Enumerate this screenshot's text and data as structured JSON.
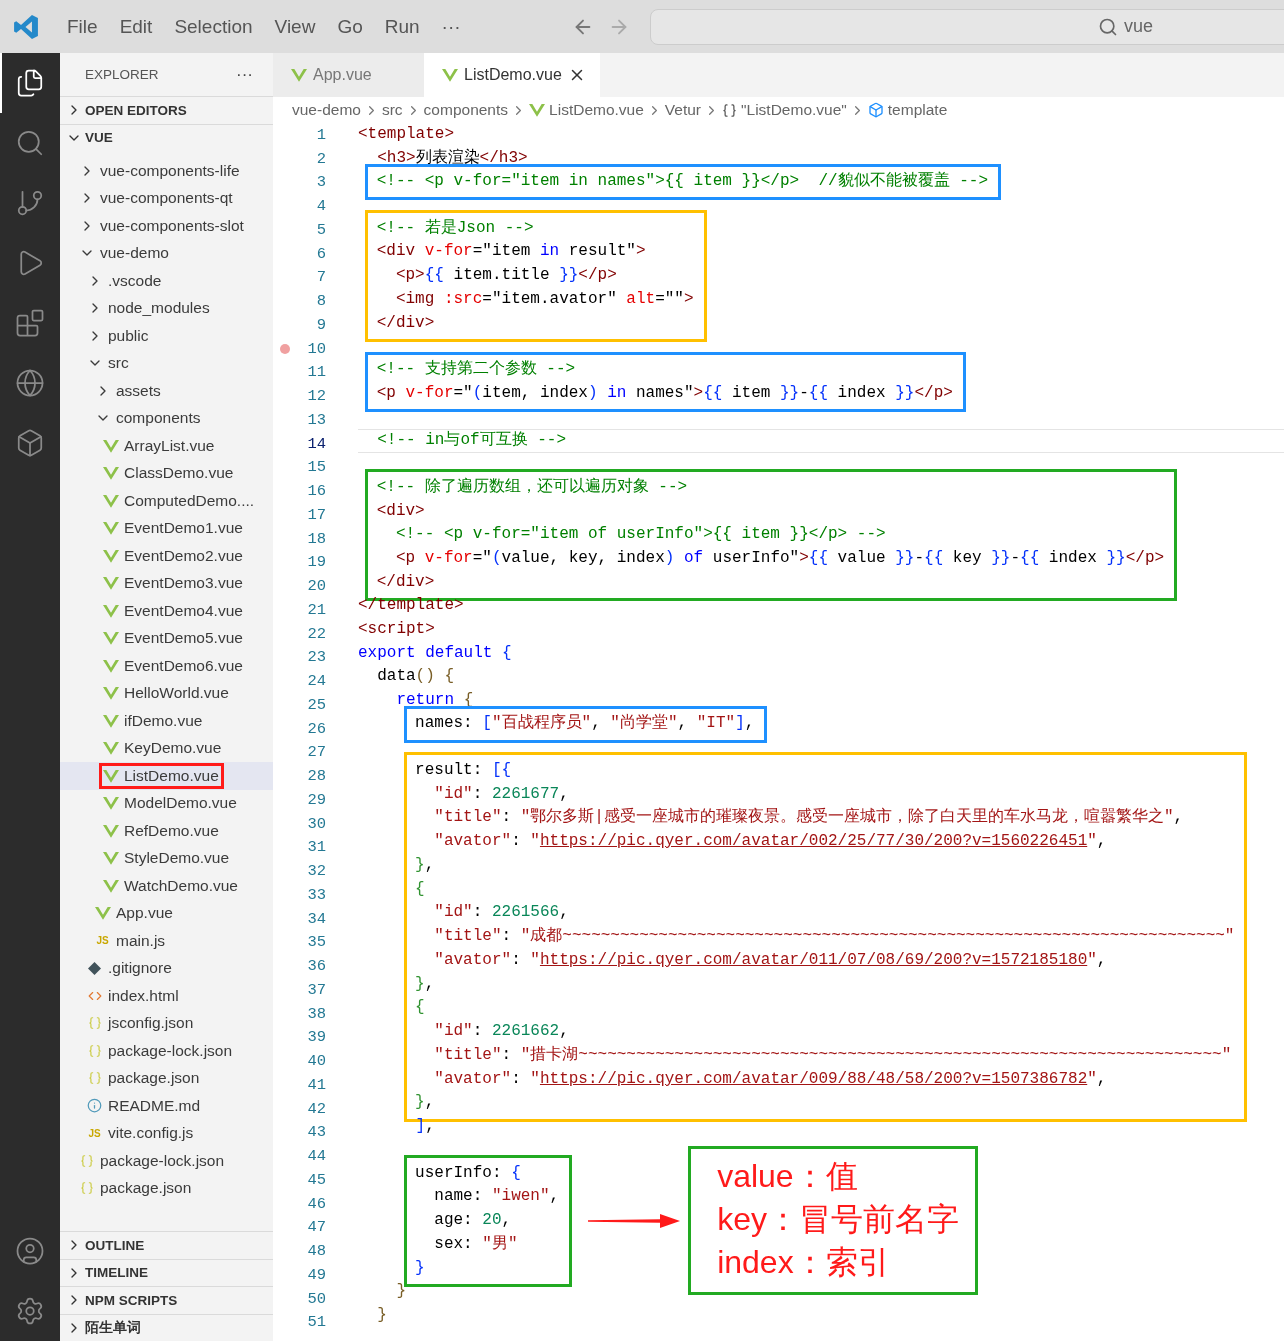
{
  "title_bar": {
    "menu": [
      "File",
      "Edit",
      "Selection",
      "View",
      "Go",
      "Run",
      "···"
    ],
    "command_center": "vue"
  },
  "activity_bar": {
    "top": [
      {
        "kind": "files",
        "selected": true
      },
      {
        "kind": "search",
        "selected": false
      },
      {
        "kind": "source-control",
        "selected": false
      },
      {
        "kind": "run",
        "selected": false
      },
      {
        "kind": "extensions",
        "selected": false
      },
      {
        "kind": "globe",
        "selected": false
      },
      {
        "kind": "cube",
        "selected": false
      }
    ],
    "bottom": [
      {
        "kind": "account"
      },
      {
        "kind": "settings"
      }
    ]
  },
  "explorer": {
    "title": "EXPLORER",
    "more": "···",
    "sections": [
      {
        "label": "OPEN EDITORS",
        "expanded": false
      },
      {
        "label": "VUE",
        "expanded": true,
        "tree": [
          {
            "label": "vue-components-life",
            "kind": "folder",
            "expanded": false,
            "selected": false,
            "outlined": false
          },
          {
            "label": "vue-components-qt",
            "kind": "folder",
            "expanded": false,
            "selected": false,
            "outlined": false
          },
          {
            "label": "vue-components-slot",
            "kind": "folder",
            "expanded": false,
            "selected": false,
            "outlined": false
          },
          {
            "label": "vue-demo",
            "kind": "folder",
            "expanded": true,
            "selected": false,
            "outlined": false,
            "children": [
              {
                "label": ".vscode",
                "kind": "folder",
                "expanded": false,
                "selected": false,
                "outlined": false
              },
              {
                "label": "node_modules",
                "kind": "folder",
                "expanded": false,
                "selected": false,
                "outlined": false
              },
              {
                "label": "public",
                "kind": "folder",
                "expanded": false,
                "selected": false,
                "outlined": false
              },
              {
                "label": "src",
                "kind": "folder",
                "expanded": true,
                "selected": false,
                "outlined": false,
                "children": [
                  {
                    "label": "assets",
                    "kind": "folder",
                    "expanded": false,
                    "selected": false,
                    "outlined": false
                  },
                  {
                    "label": "components",
                    "kind": "folder",
                    "expanded": true,
                    "selected": false,
                    "outlined": false,
                    "children": [
                      {
                        "label": "ArrayList.vue",
                        "kind": "vue",
                        "selected": false,
                        "outlined": false
                      },
                      {
                        "label": "ClassDemo.vue",
                        "kind": "vue",
                        "selected": false,
                        "outlined": false
                      },
                      {
                        "label": "ComputedDemo....",
                        "kind": "vue",
                        "selected": false,
                        "outlined": false
                      },
                      {
                        "label": "EventDemo1.vue",
                        "kind": "vue",
                        "selected": false,
                        "outlined": false
                      },
                      {
                        "label": "EventDemo2.vue",
                        "kind": "vue",
                        "selected": false,
                        "outlined": false
                      },
                      {
                        "label": "EventDemo3.vue",
                        "kind": "vue",
                        "selected": false,
                        "outlined": false
                      },
                      {
                        "label": "EventDemo4.vue",
                        "kind": "vue",
                        "selected": false,
                        "outlined": false
                      },
                      {
                        "label": "EventDemo5.vue",
                        "kind": "vue",
                        "selected": false,
                        "outlined": false
                      },
                      {
                        "label": "EventDemo6.vue",
                        "kind": "vue",
                        "selected": false,
                        "outlined": false
                      },
                      {
                        "label": "HelloWorld.vue",
                        "kind": "vue",
                        "selected": false,
                        "outlined": false
                      },
                      {
                        "label": "ifDemo.vue",
                        "kind": "vue",
                        "selected": false,
                        "outlined": false
                      },
                      {
                        "label": "KeyDemo.vue",
                        "kind": "vue",
                        "selected": false,
                        "outlined": false
                      },
                      {
                        "label": "ListDemo.vue",
                        "kind": "vue",
                        "selected": true,
                        "outlined": true
                      },
                      {
                        "label": "ModelDemo.vue",
                        "kind": "vue",
                        "selected": false,
                        "outlined": false
                      },
                      {
                        "label": "RefDemo.vue",
                        "kind": "vue",
                        "selected": false,
                        "outlined": false
                      },
                      {
                        "label": "StyleDemo.vue",
                        "kind": "vue",
                        "selected": false,
                        "outlined": false
                      },
                      {
                        "label": "WatchDemo.vue",
                        "kind": "vue",
                        "selected": false,
                        "outlined": false
                      }
                    ]
                  },
                  {
                    "label": "App.vue",
                    "kind": "vue",
                    "selected": false,
                    "outlined": false
                  },
                  {
                    "label": "main.js",
                    "kind": "js",
                    "icon_text": "JS",
                    "selected": false,
                    "outlined": false
                  }
                ]
              },
              {
                "label": ".gitignore",
                "kind": "git",
                "selected": false,
                "outlined": false
              },
              {
                "label": "index.html",
                "kind": "html",
                "selected": false,
                "outlined": false
              },
              {
                "label": "jsconfig.json",
                "kind": "json",
                "selected": false,
                "outlined": false
              },
              {
                "label": "package-lock.json",
                "kind": "json",
                "selected": false,
                "outlined": false
              },
              {
                "label": "package.json",
                "kind": "json",
                "selected": false,
                "outlined": false
              },
              {
                "label": "README.md",
                "kind": "info",
                "selected": false,
                "outlined": false
              },
              {
                "label": "vite.config.js",
                "kind": "js",
                "icon_text": "JS",
                "selected": false,
                "outlined": false
              }
            ]
          },
          {
            "label": "package-lock.json",
            "kind": "json",
            "selected": false,
            "outlined": false
          },
          {
            "label": "package.json",
            "kind": "json",
            "selected": false,
            "outlined": false
          }
        ]
      }
    ],
    "bottom_sections": [
      {
        "label": "OUTLINE",
        "expanded": false
      },
      {
        "label": "TIMELINE",
        "expanded": false
      },
      {
        "label": "NPM SCRIPTS",
        "expanded": false
      },
      {
        "label": "陌生单词",
        "expanded": false
      }
    ]
  },
  "editor": {
    "tabs": [
      {
        "label": "App.vue",
        "selected": false
      },
      {
        "label": "ListDemo.vue",
        "selected": true
      }
    ],
    "breadcrumbs": [
      {
        "label": "vue-demo",
        "kind": "folder"
      },
      {
        "label": "src",
        "kind": "folder"
      },
      {
        "label": "components",
        "kind": "folder"
      },
      {
        "label": "ListDemo.vue",
        "kind": "vue"
      },
      {
        "label": "Vetur",
        "kind": "folder"
      },
      {
        "label": "\"ListDemo.vue\"",
        "kind": "object"
      },
      {
        "label": "template",
        "kind": "element"
      }
    ],
    "blocks": [
      {
        "kind": "plain",
        "lines": [
          {
            "number": "1",
            "current": false,
            "breakpoint": false,
            "tokens": [
              {
                "kind": "tag",
                "text": "<template>"
              }
            ]
          },
          {
            "number": "2",
            "current": false,
            "breakpoint": false,
            "tokens": [
              {
                "kind": "tag",
                "text": "  <h3>"
              },
              {
                "kind": "plain",
                "text": "列表渲染"
              },
              {
                "kind": "tag",
                "text": "</h3>"
              }
            ]
          }
        ]
      },
      {
        "kind": "boxed",
        "color": "#1e90ff",
        "lines": [
          {
            "number": "3",
            "current": false,
            "breakpoint": false,
            "tokens": [
              {
                "kind": "comment",
                "text": "  <!-- <p v-for=\"item in names\">{{ item }}</p>  //貌似不能被覆盖 -->"
              }
            ]
          }
        ]
      },
      {
        "kind": "plain",
        "lines": [
          {
            "number": "4",
            "current": false,
            "breakpoint": false
          }
        ]
      },
      {
        "kind": "boxed",
        "color": "#ffc000",
        "lines": [
          {
            "number": "5",
            "current": false,
            "breakpoint": false,
            "tokens": [
              {
                "kind": "comment",
                "text": "  <!-- 若是Json -->"
              }
            ]
          },
          {
            "number": "6",
            "current": false,
            "breakpoint": false,
            "tokens": [
              {
                "kind": "tag",
                "text": "  <div"
              },
              {
                "kind": "attr",
                "text": " v-for"
              },
              {
                "kind": "plain",
                "text": "=\"item "
              },
              {
                "kind": "keyword",
                "text": "in"
              },
              {
                "kind": "plain",
                "text": " result\""
              },
              {
                "kind": "tag",
                "text": ">"
              }
            ]
          },
          {
            "number": "7",
            "current": false,
            "breakpoint": false,
            "tokens": [
              {
                "kind": "tag",
                "text": "    <p>"
              },
              {
                "kind": "brace",
                "text": "{{"
              },
              {
                "kind": "plain",
                "text": " item.title "
              },
              {
                "kind": "brace",
                "text": "}}"
              },
              {
                "kind": "tag",
                "text": "</p>"
              }
            ]
          },
          {
            "number": "8",
            "current": false,
            "breakpoint": false,
            "tokens": [
              {
                "kind": "tag",
                "text": "    <img"
              },
              {
                "kind": "attr",
                "text": " :src"
              },
              {
                "kind": "plain",
                "text": "=\"item.avator\""
              },
              {
                "kind": "attr",
                "text": " alt"
              },
              {
                "kind": "plain",
                "text": "=\"\""
              },
              {
                "kind": "tag",
                "text": ">"
              }
            ]
          },
          {
            "number": "9",
            "current": false,
            "breakpoint": false,
            "tokens": [
              {
                "kind": "tag",
                "text": "  </div>"
              }
            ]
          }
        ]
      },
      {
        "kind": "plain",
        "lines": [
          {
            "number": "10",
            "current": false,
            "breakpoint": true
          }
        ]
      },
      {
        "kind": "boxed",
        "color": "#1e90ff",
        "lines": [
          {
            "number": "11",
            "current": false,
            "breakpoint": false,
            "tokens": [
              {
                "kind": "comment",
                "text": "  <!-- 支持第二个参数 -->"
              }
            ]
          },
          {
            "number": "12",
            "current": false,
            "breakpoint": false,
            "tokens": [
              {
                "kind": "tag",
                "text": "  <p"
              },
              {
                "kind": "attr",
                "text": " v-for"
              },
              {
                "kind": "plain",
                "text": "=\""
              },
              {
                "kind": "brace",
                "text": "("
              },
              {
                "kind": "plain",
                "text": "item, index"
              },
              {
                "kind": "brace",
                "text": ") "
              },
              {
                "kind": "keyword",
                "text": "in"
              },
              {
                "kind": "plain",
                "text": " names\""
              },
              {
                "kind": "tag",
                "text": ">"
              },
              {
                "kind": "brace",
                "text": "{{"
              },
              {
                "kind": "plain",
                "text": " item "
              },
              {
                "kind": "brace",
                "text": "}}"
              },
              {
                "kind": "plain",
                "text": "-"
              },
              {
                "kind": "brace",
                "text": "{{"
              },
              {
                "kind": "plain",
                "text": " index "
              },
              {
                "kind": "brace",
                "text": "}}"
              },
              {
                "kind": "tag",
                "text": "</p>"
              }
            ]
          }
        ]
      },
      {
        "kind": "plain",
        "lines": [
          {
            "number": "13",
            "current": false,
            "breakpoint": false
          },
          {
            "number": "14",
            "current": true,
            "breakpoint": false,
            "tokens": [
              {
                "kind": "comment",
                "text": "  <!-- in与of可互换 -->"
              }
            ]
          },
          {
            "number": "15",
            "current": false,
            "breakpoint": false
          }
        ]
      },
      {
        "kind": "boxed",
        "color": "#22aa22",
        "lines": [
          {
            "number": "16",
            "current": false,
            "breakpoint": false,
            "tokens": [
              {
                "kind": "comment",
                "text": "  <!-- 除了遍历数组，还可以遍历对象 -->"
              }
            ]
          },
          {
            "number": "17",
            "current": false,
            "breakpoint": false,
            "tokens": [
              {
                "kind": "tag",
                "text": "  <div>"
              }
            ]
          },
          {
            "number": "18",
            "current": false,
            "breakpoint": false,
            "tokens": [
              {
                "kind": "comment",
                "text": "    <!-- <p v-for=\"item of userInfo\">{{ item }}</p> -->"
              }
            ]
          },
          {
            "number": "19",
            "current": false,
            "breakpoint": false,
            "tokens": [
              {
                "kind": "tag",
                "text": "    <p"
              },
              {
                "kind": "attr",
                "text": " v-for"
              },
              {
                "kind": "plain",
                "text": "=\""
              },
              {
                "kind": "brace",
                "text": "("
              },
              {
                "kind": "plain",
                "text": "value, key, index"
              },
              {
                "kind": "brace",
                "text": ") "
              },
              {
                "kind": "keyword",
                "text": "of"
              },
              {
                "kind": "plain",
                "text": " userInfo\""
              },
              {
                "kind": "tag",
                "text": ">"
              },
              {
                "kind": "brace",
                "text": "{{"
              },
              {
                "kind": "plain",
                "text": " value "
              },
              {
                "kind": "brace",
                "text": "}}"
              },
              {
                "kind": "plain",
                "text": "-"
              },
              {
                "kind": "brace",
                "text": "{{"
              },
              {
                "kind": "plain",
                "text": " key "
              },
              {
                "kind": "brace",
                "text": "}}"
              },
              {
                "kind": "plain",
                "text": "-"
              },
              {
                "kind": "brace",
                "text": "{{"
              },
              {
                "kind": "plain",
                "text": " index "
              },
              {
                "kind": "brace",
                "text": "}}"
              },
              {
                "kind": "tag",
                "text": "</p>"
              }
            ]
          },
          {
            "number": "20",
            "current": false,
            "breakpoint": false,
            "tokens": [
              {
                "kind": "tag",
                "text": "  </div>"
              }
            ]
          }
        ]
      },
      {
        "kind": "plain",
        "lines": [
          {
            "number": "21",
            "current": false,
            "breakpoint": false,
            "tokens": [
              {
                "kind": "tag",
                "text": "</template>"
              }
            ]
          },
          {
            "number": "22",
            "current": false,
            "breakpoint": false,
            "tokens": [
              {
                "kind": "tag",
                "text": "<script>"
              }
            ]
          },
          {
            "number": "23",
            "current": false,
            "breakpoint": false,
            "tokens": [
              {
                "kind": "keyword",
                "text": "export default "
              },
              {
                "kind": "brace",
                "text": "{"
              }
            ]
          },
          {
            "number": "24",
            "current": false,
            "breakpoint": false,
            "tokens": [
              {
                "kind": "plain",
                "text": "  data"
              },
              {
                "kind": "bracket",
                "text": "() {"
              }
            ]
          },
          {
            "number": "25",
            "current": false,
            "breakpoint": false,
            "tokens": [
              {
                "kind": "keyword",
                "text": "    return "
              },
              {
                "kind": "bracket",
                "text": "{"
              }
            ]
          }
        ]
      },
      {
        "kind": "boxed",
        "color": "#1e90ff",
        "lines": [
          {
            "number": "26",
            "current": false,
            "breakpoint": false,
            "tokens": [
              {
                "kind": "plain",
                "text": "      names: "
              },
              {
                "kind": "brace",
                "text": "["
              },
              {
                "kind": "string",
                "text": "\"百战程序员\""
              },
              {
                "kind": "plain",
                "text": ", "
              },
              {
                "kind": "string",
                "text": "\"尚学堂\""
              },
              {
                "kind": "plain",
                "text": ", "
              },
              {
                "kind": "string",
                "text": "\"IT\""
              },
              {
                "kind": "brace",
                "text": "]"
              },
              {
                "kind": "plain",
                "text": ","
              }
            ]
          }
        ]
      },
      {
        "kind": "plain",
        "lines": [
          {
            "number": "27",
            "current": false,
            "breakpoint": false
          }
        ]
      },
      {
        "kind": "boxed",
        "color": "#ffc000",
        "lines": [
          {
            "number": "28",
            "current": false,
            "breakpoint": false,
            "tokens": [
              {
                "kind": "plain",
                "text": "      result: "
              },
              {
                "kind": "brace",
                "text": "[{"
              }
            ]
          },
          {
            "number": "29",
            "current": false,
            "breakpoint": false,
            "tokens": [
              {
                "kind": "string",
                "text": "        \"id\""
              },
              {
                "kind": "plain",
                "text": ": "
              },
              {
                "kind": "number",
                "text": "2261677"
              },
              {
                "kind": "plain",
                "text": ","
              }
            ]
          },
          {
            "number": "30",
            "current": false,
            "breakpoint": false,
            "tokens": [
              {
                "kind": "string",
                "text": "        \"title\""
              },
              {
                "kind": "plain",
                "text": ": "
              },
              {
                "kind": "string",
                "text": "\"鄂尔多斯|感受一座城市的璀璨夜景。感受一座城市，除了白天里的车水马龙，喧嚣繁华之\""
              },
              {
                "kind": "plain",
                "text": ","
              }
            ]
          },
          {
            "number": "31",
            "current": false,
            "breakpoint": false,
            "tokens": [
              {
                "kind": "string",
                "text": "        \"avator\""
              },
              {
                "kind": "plain",
                "text": ": "
              },
              {
                "kind": "string",
                "text": "\""
              },
              {
                "kind": "link",
                "text": "https://pic.qyer.com/avatar/002/25/77/30/200?v=1560226451"
              },
              {
                "kind": "string",
                "text": "\""
              },
              {
                "kind": "plain",
                "text": ","
              }
            ]
          },
          {
            "number": "32",
            "current": false,
            "breakpoint": false,
            "tokens": [
              {
                "kind": "bracket2",
                "text": "      }"
              },
              {
                "kind": "plain",
                "text": ","
              }
            ]
          },
          {
            "number": "33",
            "current": false,
            "breakpoint": false,
            "tokens": [
              {
                "kind": "bracket2",
                "text": "      {"
              }
            ]
          },
          {
            "number": "34",
            "current": false,
            "breakpoint": false,
            "tokens": [
              {
                "kind": "string",
                "text": "        \"id\""
              },
              {
                "kind": "plain",
                "text": ": "
              },
              {
                "kind": "number",
                "text": "2261566"
              },
              {
                "kind": "plain",
                "text": ","
              }
            ]
          },
          {
            "number": "35",
            "current": false,
            "breakpoint": false,
            "tokens": [
              {
                "kind": "string",
                "text": "        \"title\""
              },
              {
                "kind": "plain",
                "text": ": "
              },
              {
                "kind": "string",
                "text": "\"成都~~~~~~~~~~~~~~~~~~~~~~~~~~~~~~~~~~~~~~~~~~~~~~~~~~~~~~~~~~~~~~~~~~~~~\""
              }
            ]
          },
          {
            "number": "36",
            "current": false,
            "breakpoint": false,
            "tokens": [
              {
                "kind": "string",
                "text": "        \"avator\""
              },
              {
                "kind": "plain",
                "text": ": "
              },
              {
                "kind": "string",
                "text": "\""
              },
              {
                "kind": "link",
                "text": "https://pic.qyer.com/avatar/011/07/08/69/200?v=1572185180"
              },
              {
                "kind": "string",
                "text": "\""
              },
              {
                "kind": "plain",
                "text": ","
              }
            ]
          },
          {
            "number": "37",
            "current": false,
            "breakpoint": false,
            "tokens": [
              {
                "kind": "bracket2",
                "text": "      }"
              },
              {
                "kind": "plain",
                "text": ","
              }
            ]
          },
          {
            "number": "38",
            "current": false,
            "breakpoint": false,
            "tokens": [
              {
                "kind": "bracket2",
                "text": "      {"
              }
            ]
          },
          {
            "number": "39",
            "current": false,
            "breakpoint": false,
            "tokens": [
              {
                "kind": "string",
                "text": "        \"id\""
              },
              {
                "kind": "plain",
                "text": ": "
              },
              {
                "kind": "number",
                "text": "2261662"
              },
              {
                "kind": "plain",
                "text": ","
              }
            ]
          },
          {
            "number": "40",
            "current": false,
            "breakpoint": false,
            "tokens": [
              {
                "kind": "string",
                "text": "        \"title\""
              },
              {
                "kind": "plain",
                "text": ": "
              },
              {
                "kind": "string",
                "text": "\"措卡湖~~~~~~~~~~~~~~~~~~~~~~~~~~~~~~~~~~~~~~~~~~~~~~~~~~~~~~~~~~~~~~~~~~~\""
              }
            ]
          },
          {
            "number": "41",
            "current": false,
            "breakpoint": false,
            "tokens": [
              {
                "kind": "string",
                "text": "        \"avator\""
              },
              {
                "kind": "plain",
                "text": ": "
              },
              {
                "kind": "string",
                "text": "\""
              },
              {
                "kind": "link",
                "text": "https://pic.qyer.com/avatar/009/88/48/58/200?v=1507386782"
              },
              {
                "kind": "string",
                "text": "\""
              },
              {
                "kind": "plain",
                "text": ","
              }
            ]
          },
          {
            "number": "42",
            "current": false,
            "breakpoint": false,
            "tokens": [
              {
                "kind": "bracket2",
                "text": "      }"
              },
              {
                "kind": "plain",
                "text": ","
              }
            ]
          }
        ]
      },
      {
        "kind": "plain",
        "lines": [
          {
            "number": "43",
            "current": false,
            "breakpoint": false,
            "tokens": [
              {
                "kind": "brace",
                "text": "      ]"
              },
              {
                "kind": "plain",
                "text": ","
              }
            ]
          },
          {
            "number": "44",
            "current": false,
            "breakpoint": false
          }
        ]
      },
      {
        "kind": "boxed",
        "color": "#22aa22",
        "note": {
          "lines": [
            "value：值",
            "key：冒号前名字",
            "index：索引"
          ]
        },
        "lines": [
          {
            "number": "45",
            "current": false,
            "breakpoint": false,
            "tokens": [
              {
                "kind": "plain",
                "text": "      userInfo: "
              },
              {
                "kind": "brace",
                "text": "{"
              }
            ]
          },
          {
            "number": "46",
            "current": false,
            "breakpoint": false,
            "tokens": [
              {
                "kind": "plain",
                "text": "        name: "
              },
              {
                "kind": "string",
                "text": "\"iwen\""
              },
              {
                "kind": "plain",
                "text": ","
              }
            ]
          },
          {
            "number": "47",
            "current": false,
            "breakpoint": false,
            "tokens": [
              {
                "kind": "plain",
                "text": "        age: "
              },
              {
                "kind": "number",
                "text": "20"
              },
              {
                "kind": "plain",
                "text": ","
              }
            ]
          },
          {
            "number": "48",
            "current": false,
            "breakpoint": false,
            "tokens": [
              {
                "kind": "plain",
                "text": "        sex: "
              },
              {
                "kind": "string",
                "text": "\"男\""
              }
            ]
          },
          {
            "number": "49",
            "current": false,
            "breakpoint": false,
            "tokens": [
              {
                "kind": "brace",
                "text": "      }"
              }
            ]
          }
        ]
      },
      {
        "kind": "plain",
        "lines": [
          {
            "number": "50",
            "current": false,
            "breakpoint": false,
            "tokens": [
              {
                "kind": "bracket",
                "text": "    }"
              }
            ]
          },
          {
            "number": "51",
            "current": false,
            "breakpoint": false,
            "tokens": [
              {
                "kind": "bracket",
                "text": "  }"
              }
            ]
          }
        ]
      }
    ]
  }
}
